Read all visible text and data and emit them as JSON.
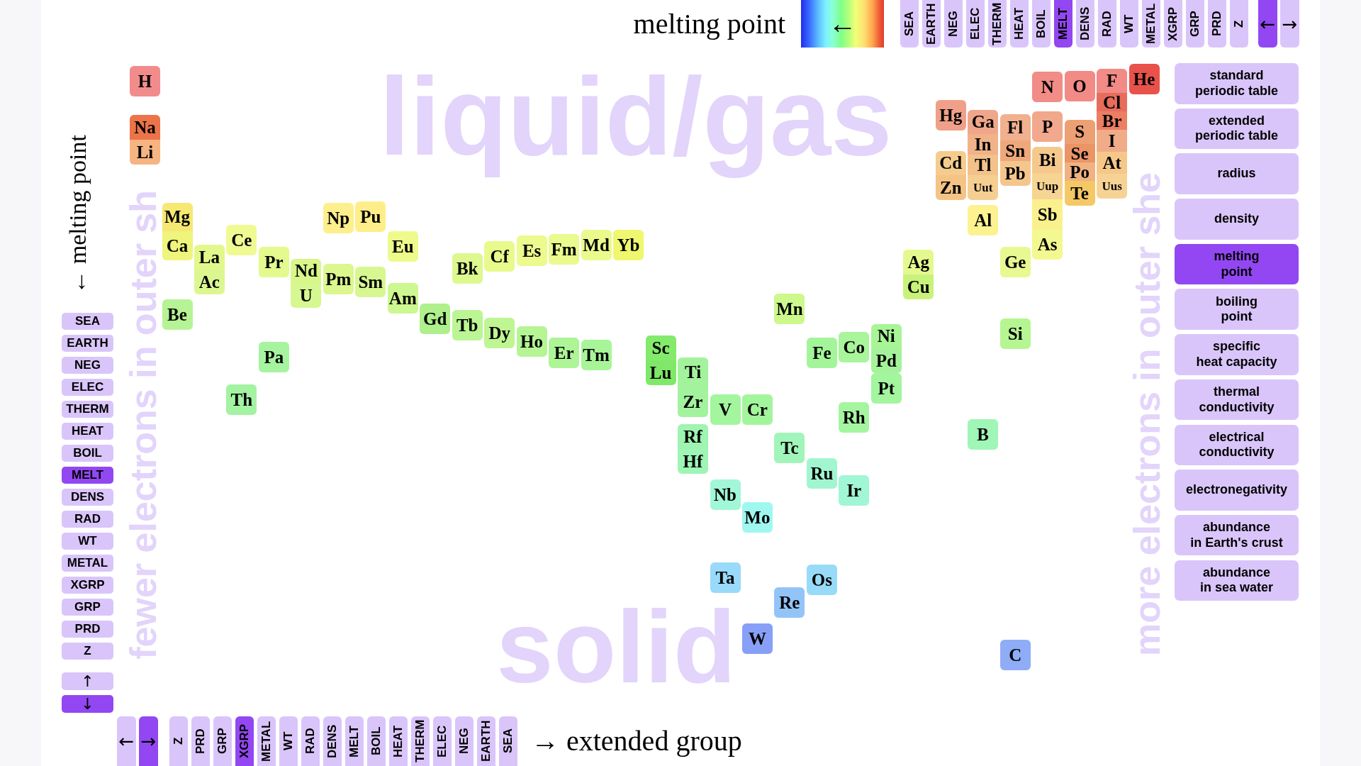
{
  "header": {
    "title": "melting point",
    "scale_arrow": "←",
    "sort_buttons": [
      {
        "label": "SEA",
        "selected": false
      },
      {
        "label": "EARTH",
        "selected": false
      },
      {
        "label": "NEG",
        "selected": false
      },
      {
        "label": "ELEC",
        "selected": false
      },
      {
        "label": "THERM",
        "selected": false
      },
      {
        "label": "HEAT",
        "selected": false
      },
      {
        "label": "BOIL",
        "selected": false
      },
      {
        "label": "MELT",
        "selected": true
      },
      {
        "label": "DENS",
        "selected": false
      },
      {
        "label": "RAD",
        "selected": false
      },
      {
        "label": "WT",
        "selected": false
      },
      {
        "label": "METAL",
        "selected": false
      },
      {
        "label": "XGRP",
        "selected": false
      },
      {
        "label": "GRP",
        "selected": false
      },
      {
        "label": "PRD",
        "selected": false
      },
      {
        "label": "Z",
        "selected": false
      }
    ],
    "nav_buttons": [
      {
        "label": "←",
        "selected": true
      },
      {
        "label": "→",
        "selected": false
      }
    ]
  },
  "left_panel": {
    "axis_label": "← melting point",
    "sort_buttons": [
      {
        "label": "SEA",
        "selected": false
      },
      {
        "label": "EARTH",
        "selected": false
      },
      {
        "label": "NEG",
        "selected": false
      },
      {
        "label": "ELEC",
        "selected": false
      },
      {
        "label": "THERM",
        "selected": false
      },
      {
        "label": "HEAT",
        "selected": false
      },
      {
        "label": "BOIL",
        "selected": false
      },
      {
        "label": "MELT",
        "selected": true
      },
      {
        "label": "DENS",
        "selected": false
      },
      {
        "label": "RAD",
        "selected": false
      },
      {
        "label": "WT",
        "selected": false
      },
      {
        "label": "METAL",
        "selected": false
      },
      {
        "label": "XGRP",
        "selected": false
      },
      {
        "label": "GRP",
        "selected": false
      },
      {
        "label": "PRD",
        "selected": false
      },
      {
        "label": "Z",
        "selected": false
      }
    ],
    "nav_buttons": [
      {
        "label": "↑",
        "selected": false
      },
      {
        "label": "↓",
        "selected": true
      }
    ]
  },
  "plot": {
    "region_labels": [
      "liquid/gas",
      "solid"
    ],
    "side_labels": [
      "fewer electrons in outer sh",
      "more electrons in outer she"
    ],
    "elements": [
      {
        "symbol": "H",
        "color": "#f28c8c"
      },
      {
        "symbol": "Na",
        "color": "#ec7448"
      },
      {
        "symbol": "Li",
        "color": "#f6b482"
      },
      {
        "symbol": "Mg",
        "color": "#f5e873"
      },
      {
        "symbol": "Ca",
        "color": "#eef47c"
      },
      {
        "symbol": "Be",
        "color": "#b6f394"
      },
      {
        "symbol": "La",
        "color": "#e2f88c"
      },
      {
        "symbol": "Ac",
        "color": "#dcf790"
      },
      {
        "symbol": "Ce",
        "color": "#effa92"
      },
      {
        "symbol": "Th",
        "color": "#a3f3a2"
      },
      {
        "symbol": "Pr",
        "color": "#e4f98e"
      },
      {
        "symbol": "Pa",
        "color": "#a6f4a0"
      },
      {
        "symbol": "Nd",
        "color": "#d9f68a"
      },
      {
        "symbol": "U",
        "color": "#d6f891"
      },
      {
        "symbol": "Np",
        "color": "#fdef8c"
      },
      {
        "symbol": "Pm",
        "color": "#dbf78e"
      },
      {
        "symbol": "Pu",
        "color": "#fdee8a"
      },
      {
        "symbol": "Sm",
        "color": "#d7f790"
      },
      {
        "symbol": "Eu",
        "color": "#effa8c"
      },
      {
        "symbol": "Am",
        "color": "#cdf790"
      },
      {
        "symbol": "Gd",
        "color": "#aef08c"
      },
      {
        "symbol": "Bk",
        "color": "#ddf88e"
      },
      {
        "symbol": "Tb",
        "color": "#bbf594"
      },
      {
        "symbol": "Cf",
        "color": "#e8fa8c"
      },
      {
        "symbol": "Dy",
        "color": "#bff592"
      },
      {
        "symbol": "Es",
        "color": "#ecfa8e"
      },
      {
        "symbol": "Ho",
        "color": "#b5f594"
      },
      {
        "symbol": "Fm",
        "color": "#eafa8c"
      },
      {
        "symbol": "Er",
        "color": "#adf596"
      },
      {
        "symbol": "Md",
        "color": "#ebfa8c"
      },
      {
        "symbol": "Tm",
        "color": "#a8f598"
      },
      {
        "symbol": "Yb",
        "color": "#eef76e"
      },
      {
        "symbol": "Sc",
        "color": "#84ea6c"
      },
      {
        "symbol": "Lu",
        "color": "#7fe868"
      },
      {
        "symbol": "Ti",
        "color": "#a3f39c"
      },
      {
        "symbol": "Zr",
        "color": "#a3f39e"
      },
      {
        "symbol": "Rf",
        "color": "#9ef4b0"
      },
      {
        "symbol": "Hf",
        "color": "#9ef5b6"
      },
      {
        "symbol": "V",
        "color": "#a3f59e"
      },
      {
        "symbol": "Nb",
        "color": "#a1f7d8"
      },
      {
        "symbol": "Ta",
        "color": "#99d9f9"
      },
      {
        "symbol": "Cr",
        "color": "#a3f59c"
      },
      {
        "symbol": "Mo",
        "color": "#9ff8ef"
      },
      {
        "symbol": "W",
        "color": "#879ff7"
      },
      {
        "symbol": "Mn",
        "color": "#ccf88c"
      },
      {
        "symbol": "Tc",
        "color": "#a1f5ba"
      },
      {
        "symbol": "Re",
        "color": "#93c4f8"
      },
      {
        "symbol": "Fe",
        "color": "#a4f59a"
      },
      {
        "symbol": "Ru",
        "color": "#a1f6d0"
      },
      {
        "symbol": "Os",
        "color": "#98dbf9"
      },
      {
        "symbol": "Co",
        "color": "#a8f59a"
      },
      {
        "symbol": "Rh",
        "color": "#a5f5a0"
      },
      {
        "symbol": "Ir",
        "color": "#a0f6d5"
      },
      {
        "symbol": "Ni",
        "color": "#a8f596"
      },
      {
        "symbol": "Pd",
        "color": "#a4f39a"
      },
      {
        "symbol": "Pt",
        "color": "#a3f59e"
      },
      {
        "symbol": "Ag",
        "color": "#e4f890"
      },
      {
        "symbol": "Cu",
        "color": "#c9f27a"
      },
      {
        "symbol": "Hg",
        "color": "#f0a08a"
      },
      {
        "symbol": "Cd",
        "color": "#f5cc8e"
      },
      {
        "symbol": "Zn",
        "color": "#f4c486"
      },
      {
        "symbol": "Ga",
        "color": "#f0a68a"
      },
      {
        "symbol": "In",
        "color": "#f0b289"
      },
      {
        "symbol": "Tl",
        "color": "#f3c18a"
      },
      {
        "symbol": "Uut",
        "color": "#f5cf92"
      },
      {
        "symbol": "Al",
        "color": "#fcf290"
      },
      {
        "symbol": "B",
        "color": "#9ff6b6"
      },
      {
        "symbol": "Fl",
        "color": "#f1b08e"
      },
      {
        "symbol": "Sn",
        "color": "#eea87c"
      },
      {
        "symbol": "Pb",
        "color": "#f4c68e"
      },
      {
        "symbol": "Ge",
        "color": "#e8f992"
      },
      {
        "symbol": "Si",
        "color": "#b5f592"
      },
      {
        "symbol": "C",
        "color": "#8facf7"
      },
      {
        "symbol": "N",
        "color": "#f28c86"
      },
      {
        "symbol": "P",
        "color": "#f1a88c"
      },
      {
        "symbol": "Bi",
        "color": "#f5c98e"
      },
      {
        "symbol": "Uup",
        "color": "#f6d492"
      },
      {
        "symbol": "Sb",
        "color": "#fbf08e"
      },
      {
        "symbol": "As",
        "color": "#f3f890"
      },
      {
        "symbol": "O",
        "color": "#f28a86"
      },
      {
        "symbol": "S",
        "color": "#eda074"
      },
      {
        "symbol": "Se",
        "color": "#eb9466"
      },
      {
        "symbol": "Po",
        "color": "#f0b282"
      },
      {
        "symbol": "Te",
        "color": "#f4c864"
      },
      {
        "symbol": "F",
        "color": "#f28a86"
      },
      {
        "symbol": "Cl",
        "color": "#e86c5c"
      },
      {
        "symbol": "Br",
        "color": "#ec7e62"
      },
      {
        "symbol": "I",
        "color": "#f0ac88"
      },
      {
        "symbol": "At",
        "color": "#f5c88a"
      },
      {
        "symbol": "Uus",
        "color": "#f6d394"
      },
      {
        "symbol": "He",
        "color": "#e8524a"
      }
    ]
  },
  "properties": [
    {
      "label": "standard\nperiodic table",
      "selected": false
    },
    {
      "label": "extended\nperiodic table",
      "selected": false
    },
    {
      "label": "radius",
      "selected": false
    },
    {
      "label": "density",
      "selected": false
    },
    {
      "label": "melting\npoint",
      "selected": true
    },
    {
      "label": "boiling\npoint",
      "selected": false
    },
    {
      "label": "specific\nheat capacity",
      "selected": false
    },
    {
      "label": "thermal\nconductivity",
      "selected": false
    },
    {
      "label": "electrical\nconductivity",
      "selected": false
    },
    {
      "label": "electronegativity",
      "selected": false
    },
    {
      "label": "abundance\nin Earth's crust",
      "selected": false
    },
    {
      "label": "abundance\nin sea water",
      "selected": false
    }
  ],
  "footer": {
    "nav_buttons": [
      {
        "label": "←",
        "selected": false
      },
      {
        "label": "→",
        "selected": true
      }
    ],
    "sort_buttons": [
      {
        "label": "Z",
        "selected": false
      },
      {
        "label": "PRD",
        "selected": false
      },
      {
        "label": "GRP",
        "selected": false
      },
      {
        "label": "XGRP",
        "selected": true
      },
      {
        "label": "METAL",
        "selected": false
      },
      {
        "label": "WT",
        "selected": false
      },
      {
        "label": "RAD",
        "selected": false
      },
      {
        "label": "DENS",
        "selected": false
      },
      {
        "label": "MELT",
        "selected": false
      },
      {
        "label": "BOIL",
        "selected": false
      },
      {
        "label": "HEAT",
        "selected": false
      },
      {
        "label": "THERM",
        "selected": false
      },
      {
        "label": "ELEC",
        "selected": false
      },
      {
        "label": "NEG",
        "selected": false
      },
      {
        "label": "EARTH",
        "selected": false
      },
      {
        "label": "SEA",
        "selected": false
      }
    ],
    "axis_label": "→ extended group"
  }
}
